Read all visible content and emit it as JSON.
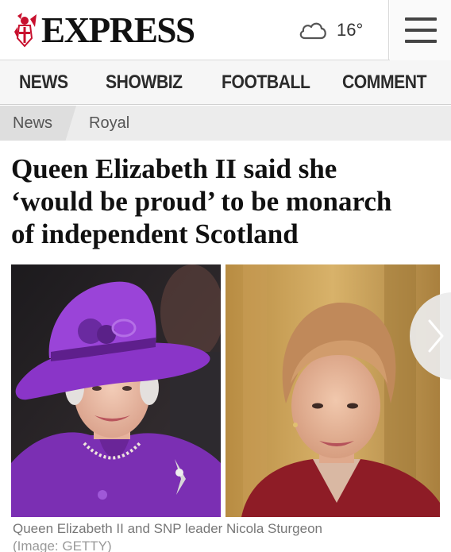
{
  "header": {
    "logo_text": "EXPRESS",
    "weather": {
      "icon": "cloud-icon",
      "temperature": "16°"
    },
    "menu_icon": "hamburger-menu-icon"
  },
  "nav": {
    "items": [
      {
        "label": "NEWS"
      },
      {
        "label": "SHOWBIZ"
      },
      {
        "label": "FOOTBALL"
      },
      {
        "label": "COMMENT"
      }
    ]
  },
  "breadcrumb": {
    "items": [
      {
        "label": "News"
      },
      {
        "label": "Royal"
      }
    ]
  },
  "article": {
    "headline_lines": [
      "Queen Elizabeth II said she",
      "‘would be proud’ to be monarch",
      "of independent Scotland"
    ],
    "image": {
      "caption": "Queen Elizabeth II and SNP leader Nicola Sturgeon",
      "credit": "(Image: GETTY)",
      "next_icon": "chevron-right-icon"
    }
  },
  "colors": {
    "brand_red": "#c8102e",
    "queen_purple": "#7b2fb3",
    "sturgeon_red": "#8e1c26",
    "nav_bg": "#f6f6f6",
    "breadcrumb_bg": "#ececec"
  }
}
